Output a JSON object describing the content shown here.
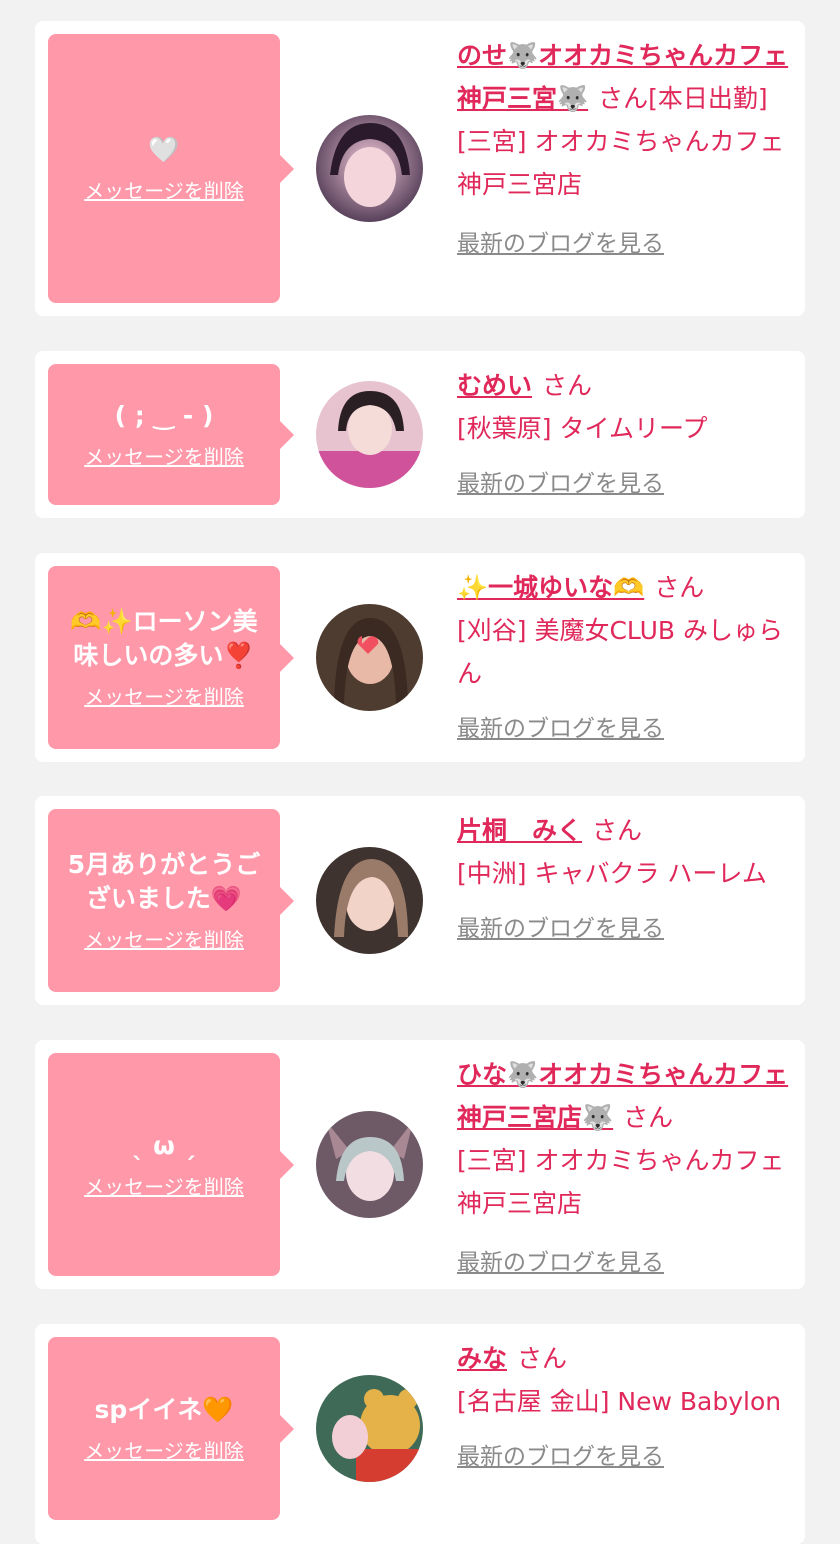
{
  "delete_label": "メッセージを削除",
  "blog_label": "最新のブログを見る",
  "san": "さん",
  "items": [
    {
      "message": "🤍",
      "name": "のせ🐺オオカミちゃんカフェ神戸三宮🐺",
      "name_suffix": "[本日出勤]",
      "shop": "[三宮] オオカミちゃんカフェ神戸三宮店",
      "avatar_color": "#6a4d63"
    },
    {
      "message": "( ; ‿ - )",
      "name": "むめい",
      "name_suffix": "",
      "shop": "[秋葉原] タイムリープ",
      "avatar_color": "#c979a7"
    },
    {
      "message": "🫶✨ローソン美味しいの多い❣️",
      "name": "✨一城ゆいな🫶",
      "name_suffix": "",
      "shop": "[刈谷] 美魔女CLUB みしゅらん",
      "avatar_color": "#7b5a46"
    },
    {
      "message": "5月ありがとうございました💗",
      "name": "片桐　みく",
      "name_suffix": "",
      "shop": "[中洲] キャバクラ ハーレム",
      "avatar_color": "#8f7468"
    },
    {
      "message": "ˎ ω ˏ",
      "name": "ひな🐺オオカミちゃんカフェ神戸三宮店🐺",
      "name_suffix": "",
      "shop": "[三宮] オオカミちゃんカフェ神戸三宮店",
      "avatar_color": "#8b7585"
    },
    {
      "message": "spイイネ🧡",
      "name": "みな",
      "name_suffix": "",
      "shop": "[名古屋 金山] New Babylon",
      "avatar_color": "#c9a23c"
    }
  ]
}
